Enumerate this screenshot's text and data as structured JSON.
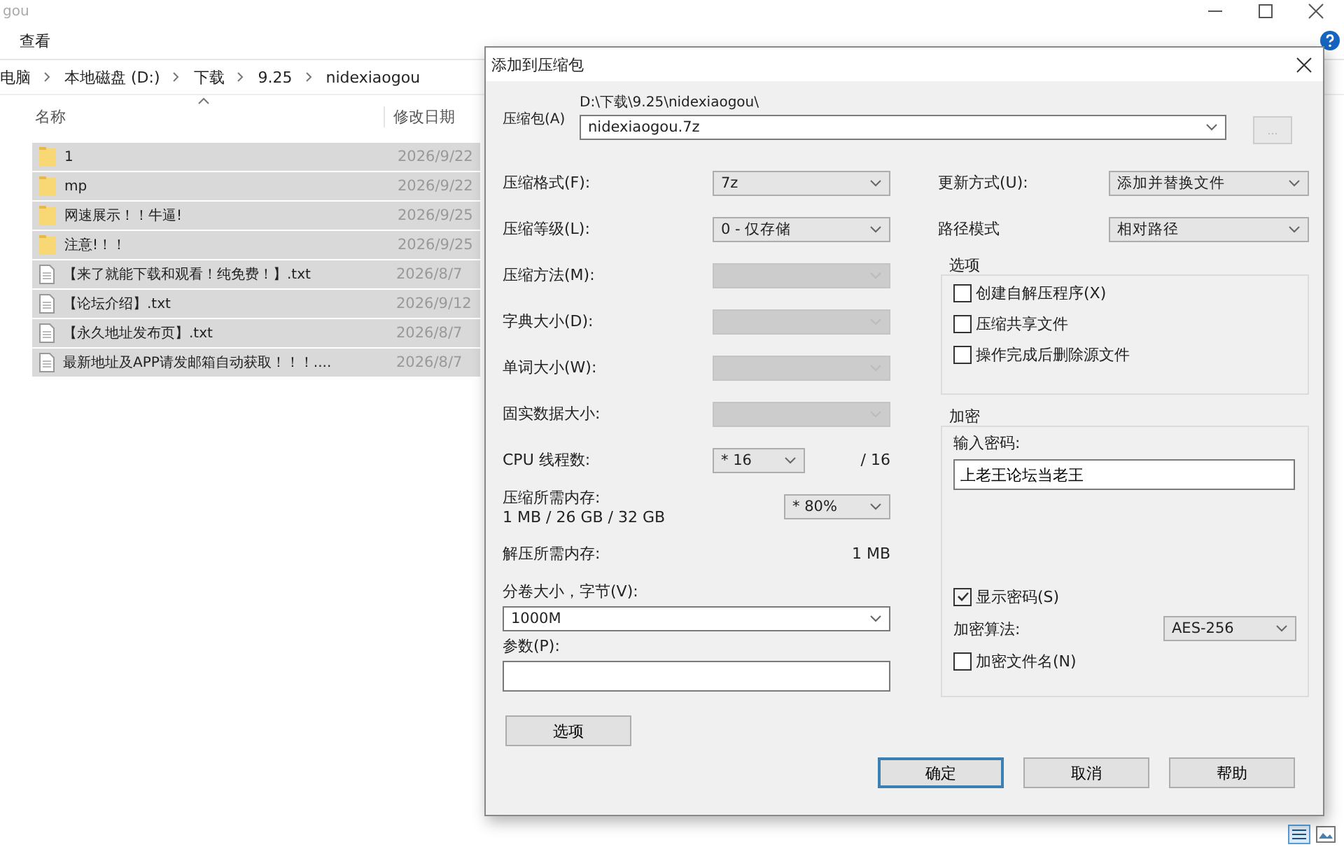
{
  "explorer": {
    "title": "gou",
    "menu": [
      "查看"
    ],
    "breadcrumb": [
      "电脑",
      "本地磁盘 (D:)",
      "下载",
      "9.25",
      "nidexiaogou"
    ],
    "columns": [
      "名称",
      "修改日期"
    ],
    "rows": [
      {
        "kind": "folder",
        "name": "1",
        "date": "2026/9/22",
        "selected": true
      },
      {
        "kind": "folder",
        "name": "mp",
        "date": "2026/9/22",
        "selected": true
      },
      {
        "kind": "folder",
        "name": "网速展示！！牛逼!",
        "date": "2026/9/25",
        "selected": true
      },
      {
        "kind": "folder",
        "name": "注意!！！",
        "date": "2026/9/25",
        "selected": true
      },
      {
        "kind": "file",
        "name": "【来了就能下载和观看！纯免费！】.txt",
        "date": "2026/8/7",
        "selected": true
      },
      {
        "kind": "file",
        "name": "【论坛介绍】.txt",
        "date": "2026/9/12",
        "selected": true
      },
      {
        "kind": "file",
        "name": "【永久地址发布页】.txt",
        "date": "2026/8/7",
        "selected": true
      },
      {
        "kind": "file",
        "name": "最新地址及APP请发邮箱自动获取！！！....",
        "date": "2026/8/7",
        "selected": true
      }
    ]
  },
  "dialog": {
    "title": "添加到压缩包",
    "archive": {
      "label": "压缩包(A)",
      "path": "D:\\下载\\9.25\\nidexiaogou\\",
      "value": "nidexiaogou.7z",
      "browse": "..."
    },
    "left_fields": [
      {
        "label": "压缩格式(F):",
        "value": "7z",
        "disabled": false
      },
      {
        "label": "压缩等级(L):",
        "value": "0 - 仅存储",
        "disabled": false
      },
      {
        "label": "压缩方法(M):",
        "disabled": true
      },
      {
        "label": "字典大小(D):",
        "disabled": true
      },
      {
        "label": "单词大小(W):",
        "disabled": true
      },
      {
        "label": "固实数据大小:",
        "disabled": true
      }
    ],
    "cpu": {
      "label": "CPU 线程数:",
      "value": "* 16",
      "max": "/ 16"
    },
    "memory": {
      "label": "压缩所需内存:",
      "detail": "1 MB / 26 GB / 32 GB",
      "value": "* 80%"
    },
    "decompress": {
      "label": "解压所需内存:",
      "value": "1 MB"
    },
    "volume": {
      "label": "分卷大小，字节(V):",
      "value": "1000M"
    },
    "params": {
      "label": "参数(P):"
    },
    "options_button": "选项",
    "right_fields": [
      {
        "label": "更新方式(U):",
        "value": "添加并替换文件"
      },
      {
        "label": "路径模式",
        "value": "相对路径"
      }
    ],
    "options": {
      "title": "选项",
      "items": [
        {
          "label": "创建自解压程序(X)",
          "checked": false
        },
        {
          "label": "压缩共享文件",
          "checked": false
        },
        {
          "label": "操作完成后删除源文件",
          "checked": false
        }
      ]
    },
    "encryption": {
      "title": "加密",
      "password_label": "输入密码:",
      "password": "上老王论坛当老王",
      "show_password": {
        "label": "显示密码(S)",
        "checked": true
      },
      "method_label": "加密算法:",
      "method": "AES-256",
      "encrypt_names": {
        "label": "加密文件名(N)",
        "checked": false
      }
    },
    "buttons": [
      {
        "label": "确定",
        "kind": "default"
      },
      {
        "label": "取消",
        "kind": "normal"
      },
      {
        "label": "帮助",
        "kind": "normal"
      }
    ]
  }
}
